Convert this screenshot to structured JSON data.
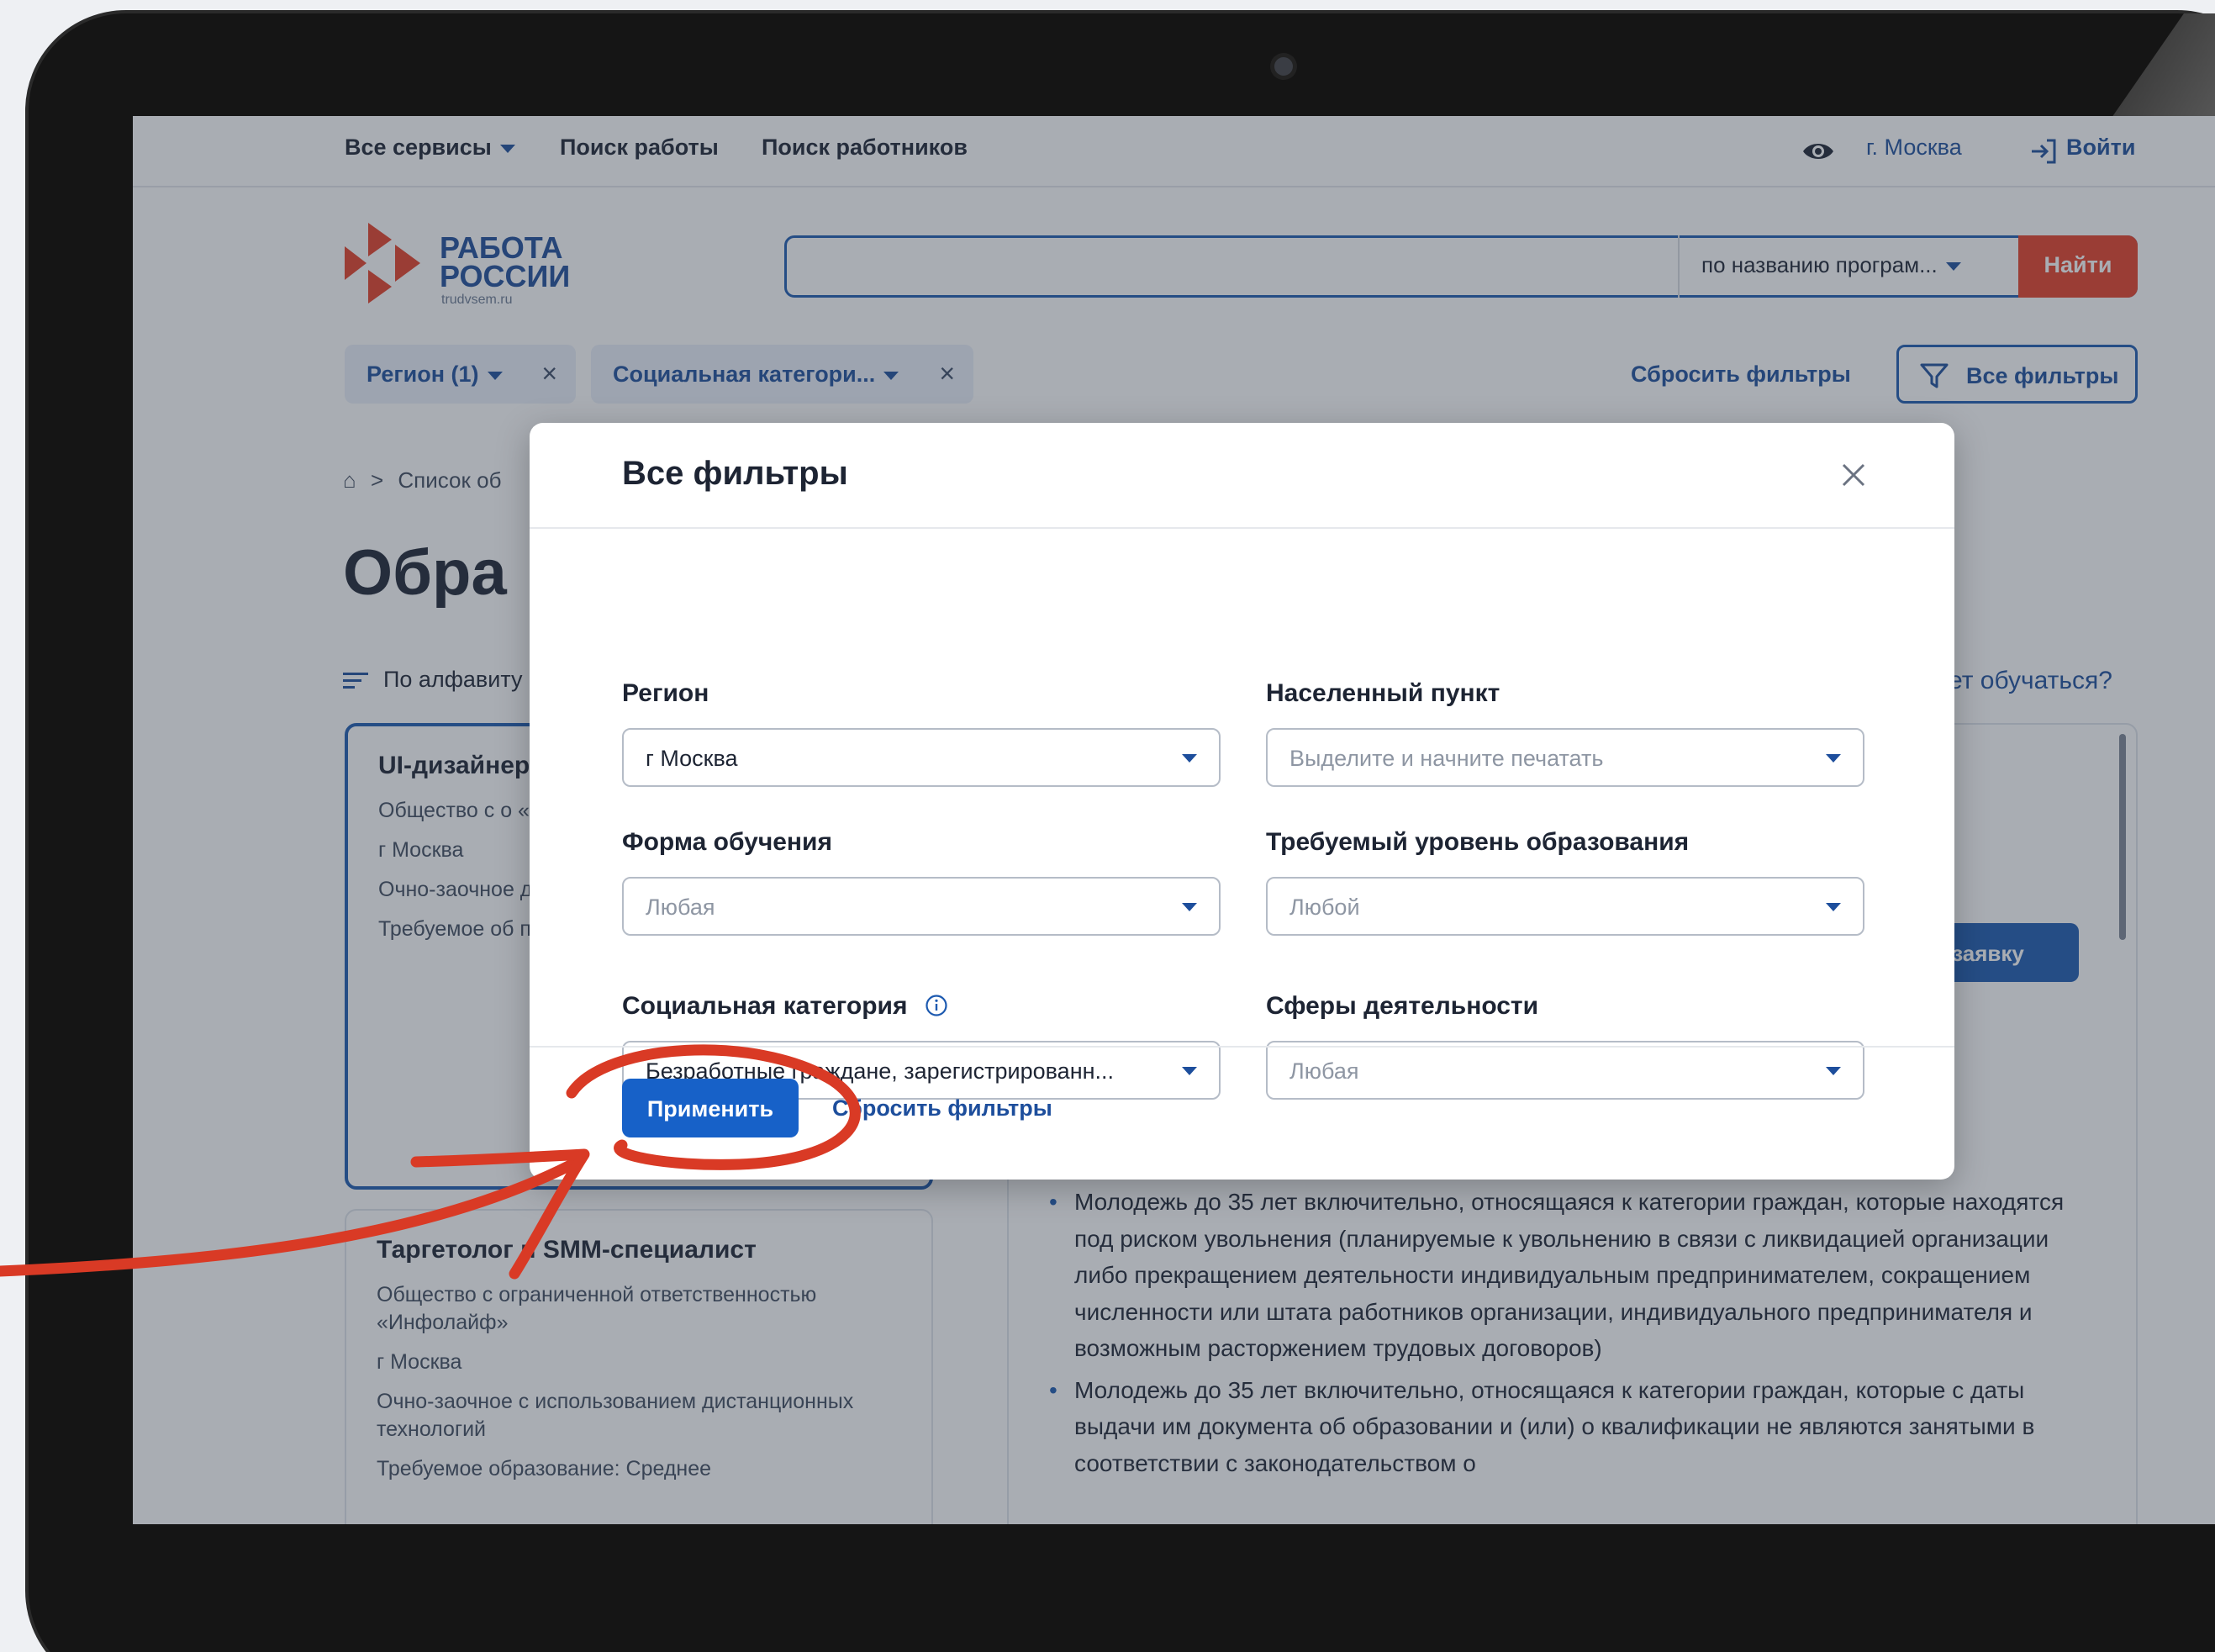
{
  "nav": {
    "all_services": "Все сервисы",
    "job_search": "Поиск работы",
    "employee_search": "Поиск работников",
    "city": "г. Москва",
    "login": "Войти"
  },
  "logo": {
    "line1": "РАБОТА",
    "line2": "РОССИИ",
    "sub": "trudvsem.ru"
  },
  "search": {
    "value": "",
    "mode": "по названию програм...",
    "button": "Найти"
  },
  "chips": [
    {
      "label": "Регион (1)"
    },
    {
      "label": "Социальная категори..."
    }
  ],
  "filters_bar": {
    "reset": "Сбросить фильтры",
    "all_filters": "Все фильтры"
  },
  "background": {
    "breadcrumb_home": "⌂",
    "breadcrumb_sep": ">",
    "breadcrumb_text": "Список об",
    "page_title": "Обра",
    "sort": "По алфавиту",
    "right_link": "ет обучаться?",
    "apply_button": "ь заявку",
    "card1": {
      "title": "UI-дизайнер дизайнера",
      "org": "Общество с о «Центральная профессиона",
      "city": "г Москва",
      "form": "Очно-заочное дистанционн",
      "edu": "Требуемое об профессиона"
    },
    "card2": {
      "title": "Таргетолог и SMM-специалист",
      "org": "Общество с ограниченной ответственностью «Инфолайф»",
      "city": "г Москва",
      "form": "Очно-заочное с использованием дистанционных технологий",
      "edu": "Требуемое образование: Среднее"
    },
    "bullets": [
      "Молодежь до 35 лет включительно, относящаяся к категории граждан, которые находятся под риском увольнения (планируемые к увольнению в связи с ликвидацией организации либо прекращением деятельности индивидуальным предпринимателем, сокращением численности или штата работников организации, индивидуального предпринимателя и возможным расторжением трудовых договоров)",
      "Молодежь до 35 лет включительно, относящаяся к категории граждан, которые с даты выдачи им документа об образовании и (или) о квалификации не являются занятыми в соответствии с законодательством о"
    ]
  },
  "modal": {
    "title": "Все фильтры",
    "fields": {
      "region": {
        "label": "Регион",
        "value": "г Москва"
      },
      "locality": {
        "label": "Населенный пункт",
        "placeholder": "Выделите и начните печатать"
      },
      "study_form": {
        "label": "Форма обучения",
        "placeholder": "Любая"
      },
      "education_level": {
        "label": "Требуемый уровень образования",
        "placeholder": "Любой"
      },
      "social_category": {
        "label": "Социальная категория",
        "value": "Безработные граждане, зарегистрированн..."
      },
      "activity_sphere": {
        "label": "Сферы деятельности",
        "placeholder": "Любая"
      }
    },
    "apply": "Применить",
    "reset": "Сбросить фильтры"
  },
  "colors": {
    "primary": "#1761c8",
    "brand_blue": "#1e4c9a",
    "brand_red": "#e53e27",
    "annotation": "#d93a25"
  },
  "icons": [
    "eye-icon",
    "login-icon",
    "logo-icon",
    "funnel-icon",
    "close-icon",
    "info-icon",
    "chevron-down-icon",
    "sort-icon"
  ]
}
